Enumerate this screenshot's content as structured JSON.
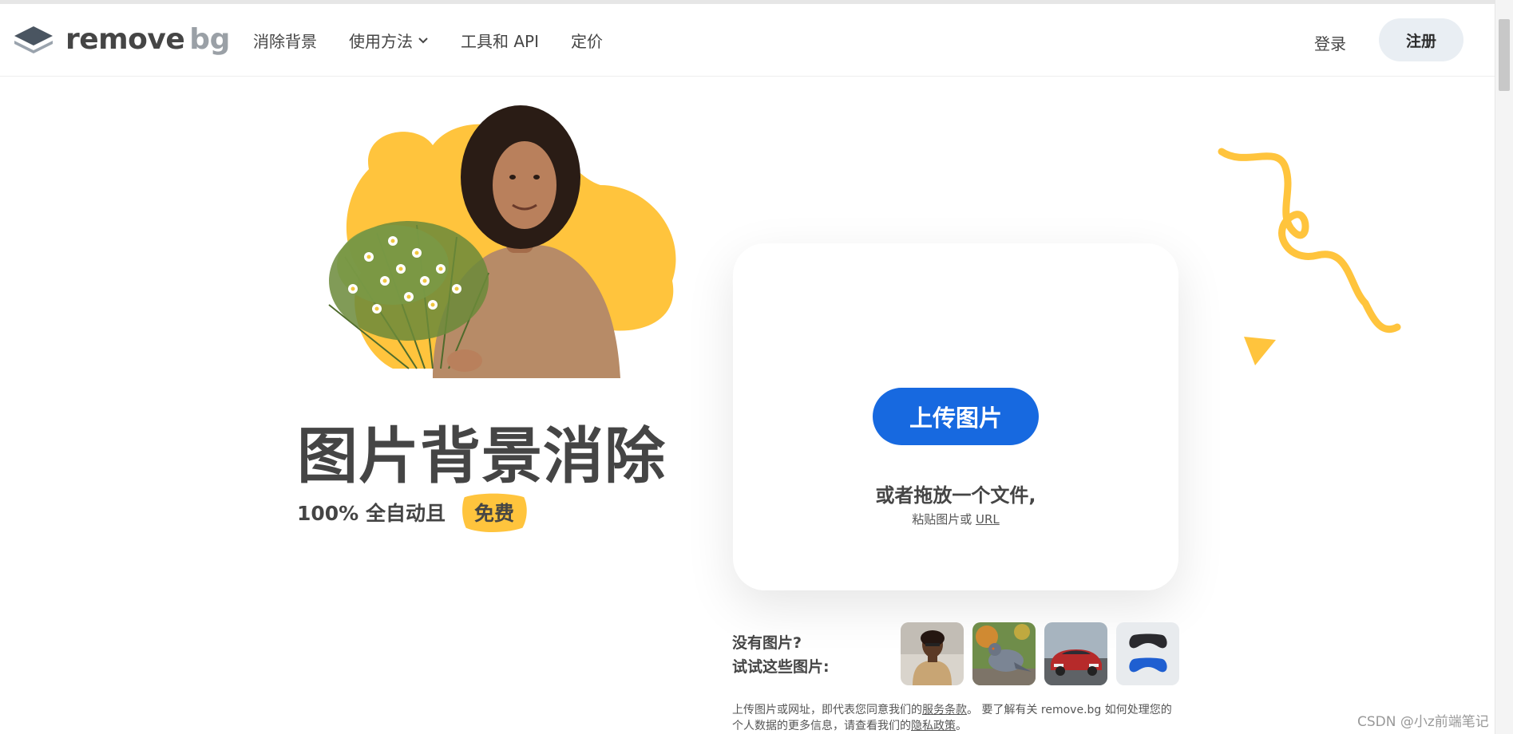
{
  "header": {
    "logo_word1": "remove",
    "logo_word2": "bg",
    "nav": [
      {
        "label": "消除背景"
      },
      {
        "label": "使用方法"
      },
      {
        "label": "工具和 API"
      },
      {
        "label": "定价"
      }
    ],
    "login": "登录",
    "signup": "注册"
  },
  "hero": {
    "title": "图片背景消除",
    "subtitle": "100% 全自动且",
    "badge": "免费"
  },
  "upload": {
    "button": "上传图片",
    "drop_text": "或者拖放一个文件,",
    "paste_prefix": "粘贴图片或",
    "paste_link": "URL"
  },
  "samples": {
    "line1": "没有图片?",
    "line2": "试试这些图片:"
  },
  "terms": {
    "t1": "上传图片或网址，即代表您同意我们的",
    "link1": "服务条款",
    "t2": "。 要了解有关 remove.bg 如何处理您的个人数据的更多信息，请查看我们的",
    "link2": "隐私政策",
    "t3": "。"
  },
  "watermark": "CSDN @小z前端笔记",
  "colors": {
    "accent_blue": "#1769e0",
    "yellow": "#ffc43d",
    "text_dark": "#454545"
  }
}
